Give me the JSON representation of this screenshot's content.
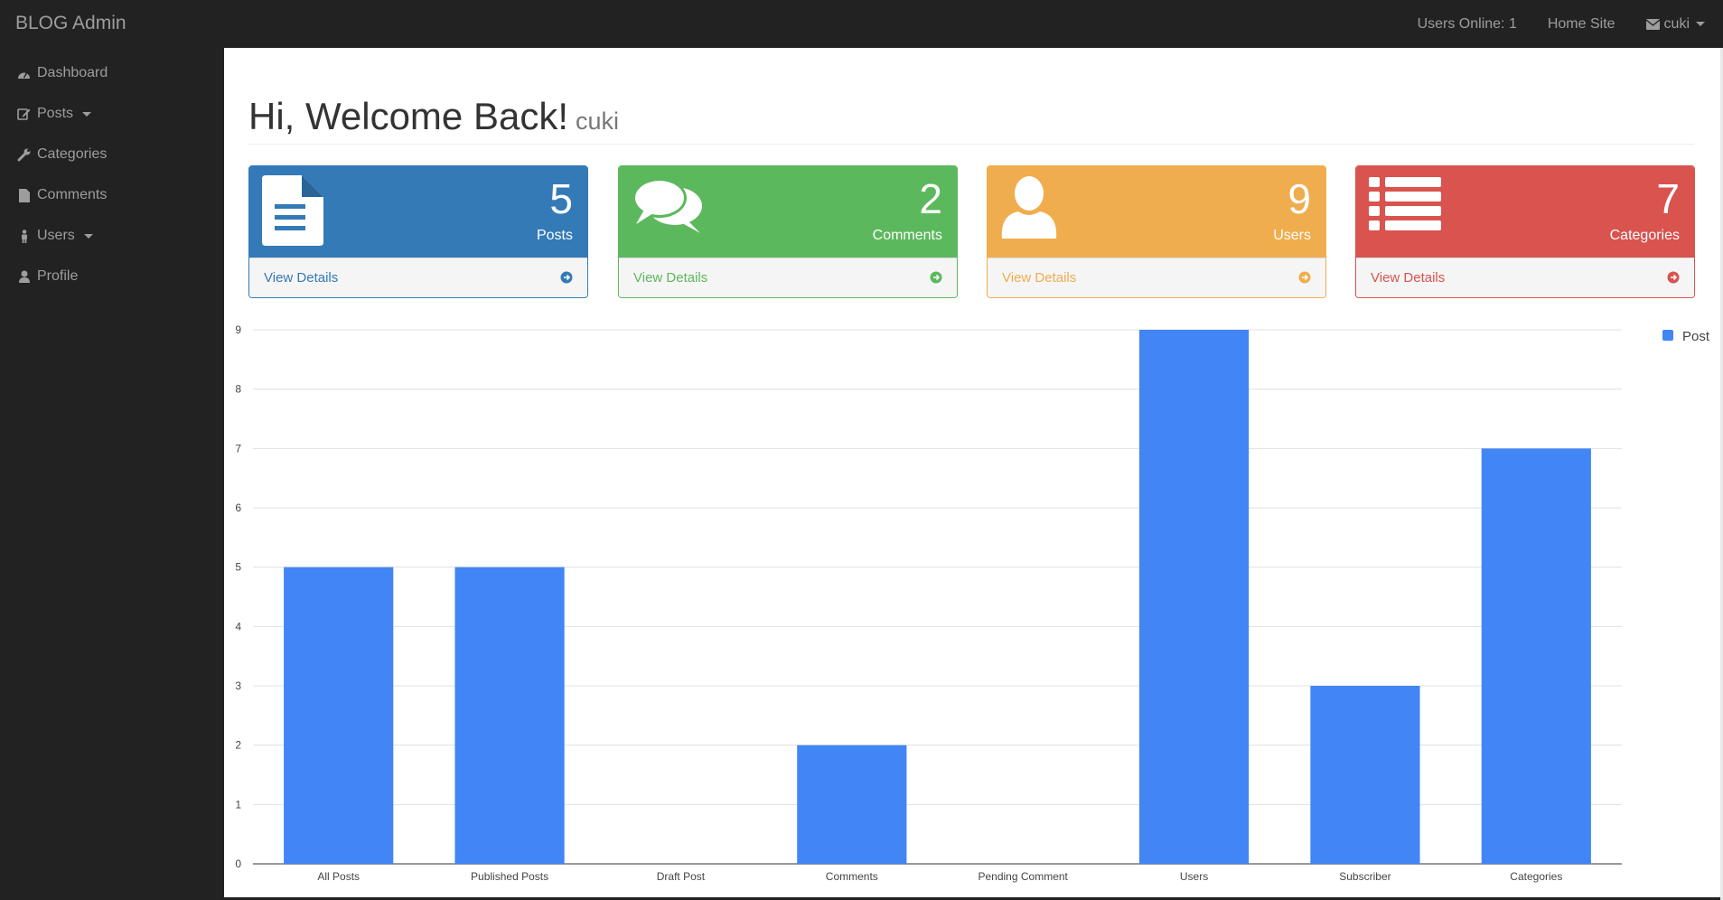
{
  "topbar": {
    "brand": "BLOG Admin",
    "users_online": "Users Online: 1",
    "home_site": "Home Site",
    "user": "cuki"
  },
  "sidebar": {
    "items": [
      {
        "label": "Dashboard",
        "icon": "dashboard-icon"
      },
      {
        "label": "Posts",
        "icon": "edit-icon",
        "has_caret": true
      },
      {
        "label": "Categories",
        "icon": "wrench-icon"
      },
      {
        "label": "Comments",
        "icon": "file-icon"
      },
      {
        "label": "Users",
        "icon": "user-male-icon",
        "has_caret": true
      },
      {
        "label": "Profile",
        "icon": "user-icon"
      }
    ]
  },
  "main": {
    "title": "Hi, Welcome Back!",
    "subtitle": "cuki",
    "panels": [
      {
        "count": "5",
        "label": "Posts",
        "link": "View Details",
        "color": "#337ab7",
        "icon": "file-text-icon"
      },
      {
        "count": "2",
        "label": "Comments",
        "link": "View Details",
        "color": "#5cb85c",
        "icon": "comments-icon"
      },
      {
        "count": "9",
        "label": "Users",
        "link": "View Details",
        "color": "#f0ad4e",
        "icon": "user-icon"
      },
      {
        "count": "7",
        "label": "Categories",
        "link": "View Details",
        "color": "#d9534f",
        "icon": "list-icon"
      }
    ]
  },
  "chart_data": {
    "type": "bar",
    "categories": [
      "All Posts",
      "Published Posts",
      "Draft Post",
      "Comments",
      "Pending Comment",
      "Users",
      "Subscriber",
      "Categories"
    ],
    "series": [
      {
        "name": "Post",
        "values": [
          5,
          5,
          0,
          2,
          0,
          9,
          3,
          7
        ],
        "color": "#4285f4"
      }
    ],
    "ylim": [
      0,
      9
    ],
    "yticks": [
      0,
      1,
      2,
      3,
      4,
      5,
      6,
      7,
      8,
      9
    ],
    "grid": true,
    "legend": "top-right"
  }
}
